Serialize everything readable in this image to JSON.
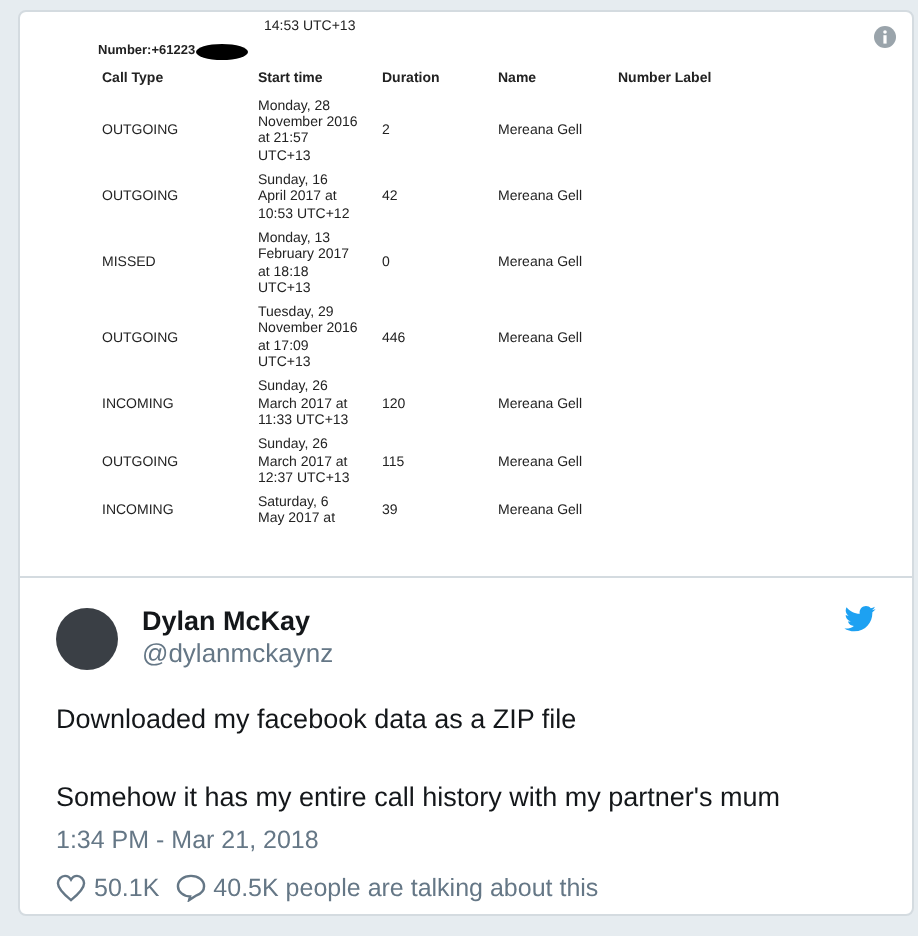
{
  "document": {
    "partial_line": "14:53 UTC+13",
    "number_label": "Number:+61223",
    "columns": [
      "Call Type",
      "Start time",
      "Duration",
      "Name",
      "Number Label"
    ],
    "rows": [
      {
        "call_type": "OUTGOING",
        "start_time": "Monday, 28\nNovember 2016\nat 21:57\nUTC+13",
        "duration": "2",
        "name": "Mereana Gell"
      },
      {
        "call_type": "OUTGOING",
        "start_time": "Sunday, 16\nApril 2017 at\n10:53 UTC+12",
        "duration": "42",
        "name": "Mereana Gell"
      },
      {
        "call_type": "MISSED",
        "start_time": "Monday, 13\nFebruary 2017\nat 18:18\nUTC+13",
        "duration": "0",
        "name": "Mereana Gell"
      },
      {
        "call_type": "OUTGOING",
        "start_time": "Tuesday, 29\nNovember 2016\nat 17:09\nUTC+13",
        "duration": "446",
        "name": "Mereana Gell"
      },
      {
        "call_type": "INCOMING",
        "start_time": "Sunday, 26\nMarch 2017 at\n11:33 UTC+13",
        "duration": "120",
        "name": "Mereana Gell"
      },
      {
        "call_type": "OUTGOING",
        "start_time": "Sunday, 26\nMarch 2017 at\n12:37 UTC+13",
        "duration": "115",
        "name": "Mereana Gell"
      },
      {
        "call_type": "INCOMING",
        "start_time": "Saturday, 6\nMay 2017 at",
        "duration": "39",
        "name": "Mereana Gell"
      }
    ]
  },
  "tweet": {
    "author": "Dylan McKay",
    "handle": "@dylanmckaynz",
    "paragraphs": [
      "Downloaded my facebook data as a ZIP file",
      "Somehow it has my entire call history with my partner's mum"
    ],
    "timestamp": "1:34 PM - Mar 21, 2018",
    "likes": "50.1K",
    "talking": "40.5K people are talking about this"
  }
}
